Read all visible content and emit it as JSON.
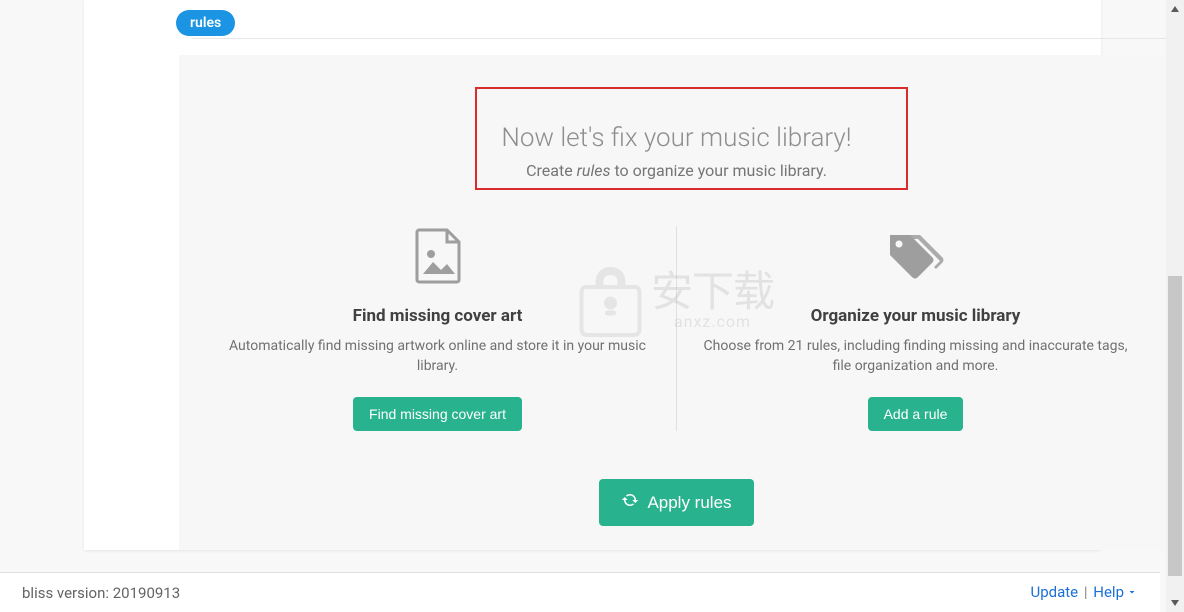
{
  "badge_label": "rules",
  "heading": "Now let's fix your music library!",
  "subheading_prefix": "Create ",
  "subheading_em": "rules",
  "subheading_suffix": " to organize your music library.",
  "columns": {
    "left": {
      "title": "Find missing cover art",
      "desc": "Automatically find missing artwork online and store it in your music library.",
      "button": "Find missing cover art"
    },
    "right": {
      "title": "Organize your music library",
      "desc": "Choose from 21 rules, including finding missing and inaccurate tags, file organization and more.",
      "button": "Add a rule"
    }
  },
  "apply_button": "Apply rules",
  "watermark": {
    "chars": "安下载",
    "sub": "anxz.com"
  },
  "footer": {
    "version_prefix": "bliss version: ",
    "version": "20190913",
    "update": "Update",
    "help": "Help"
  }
}
